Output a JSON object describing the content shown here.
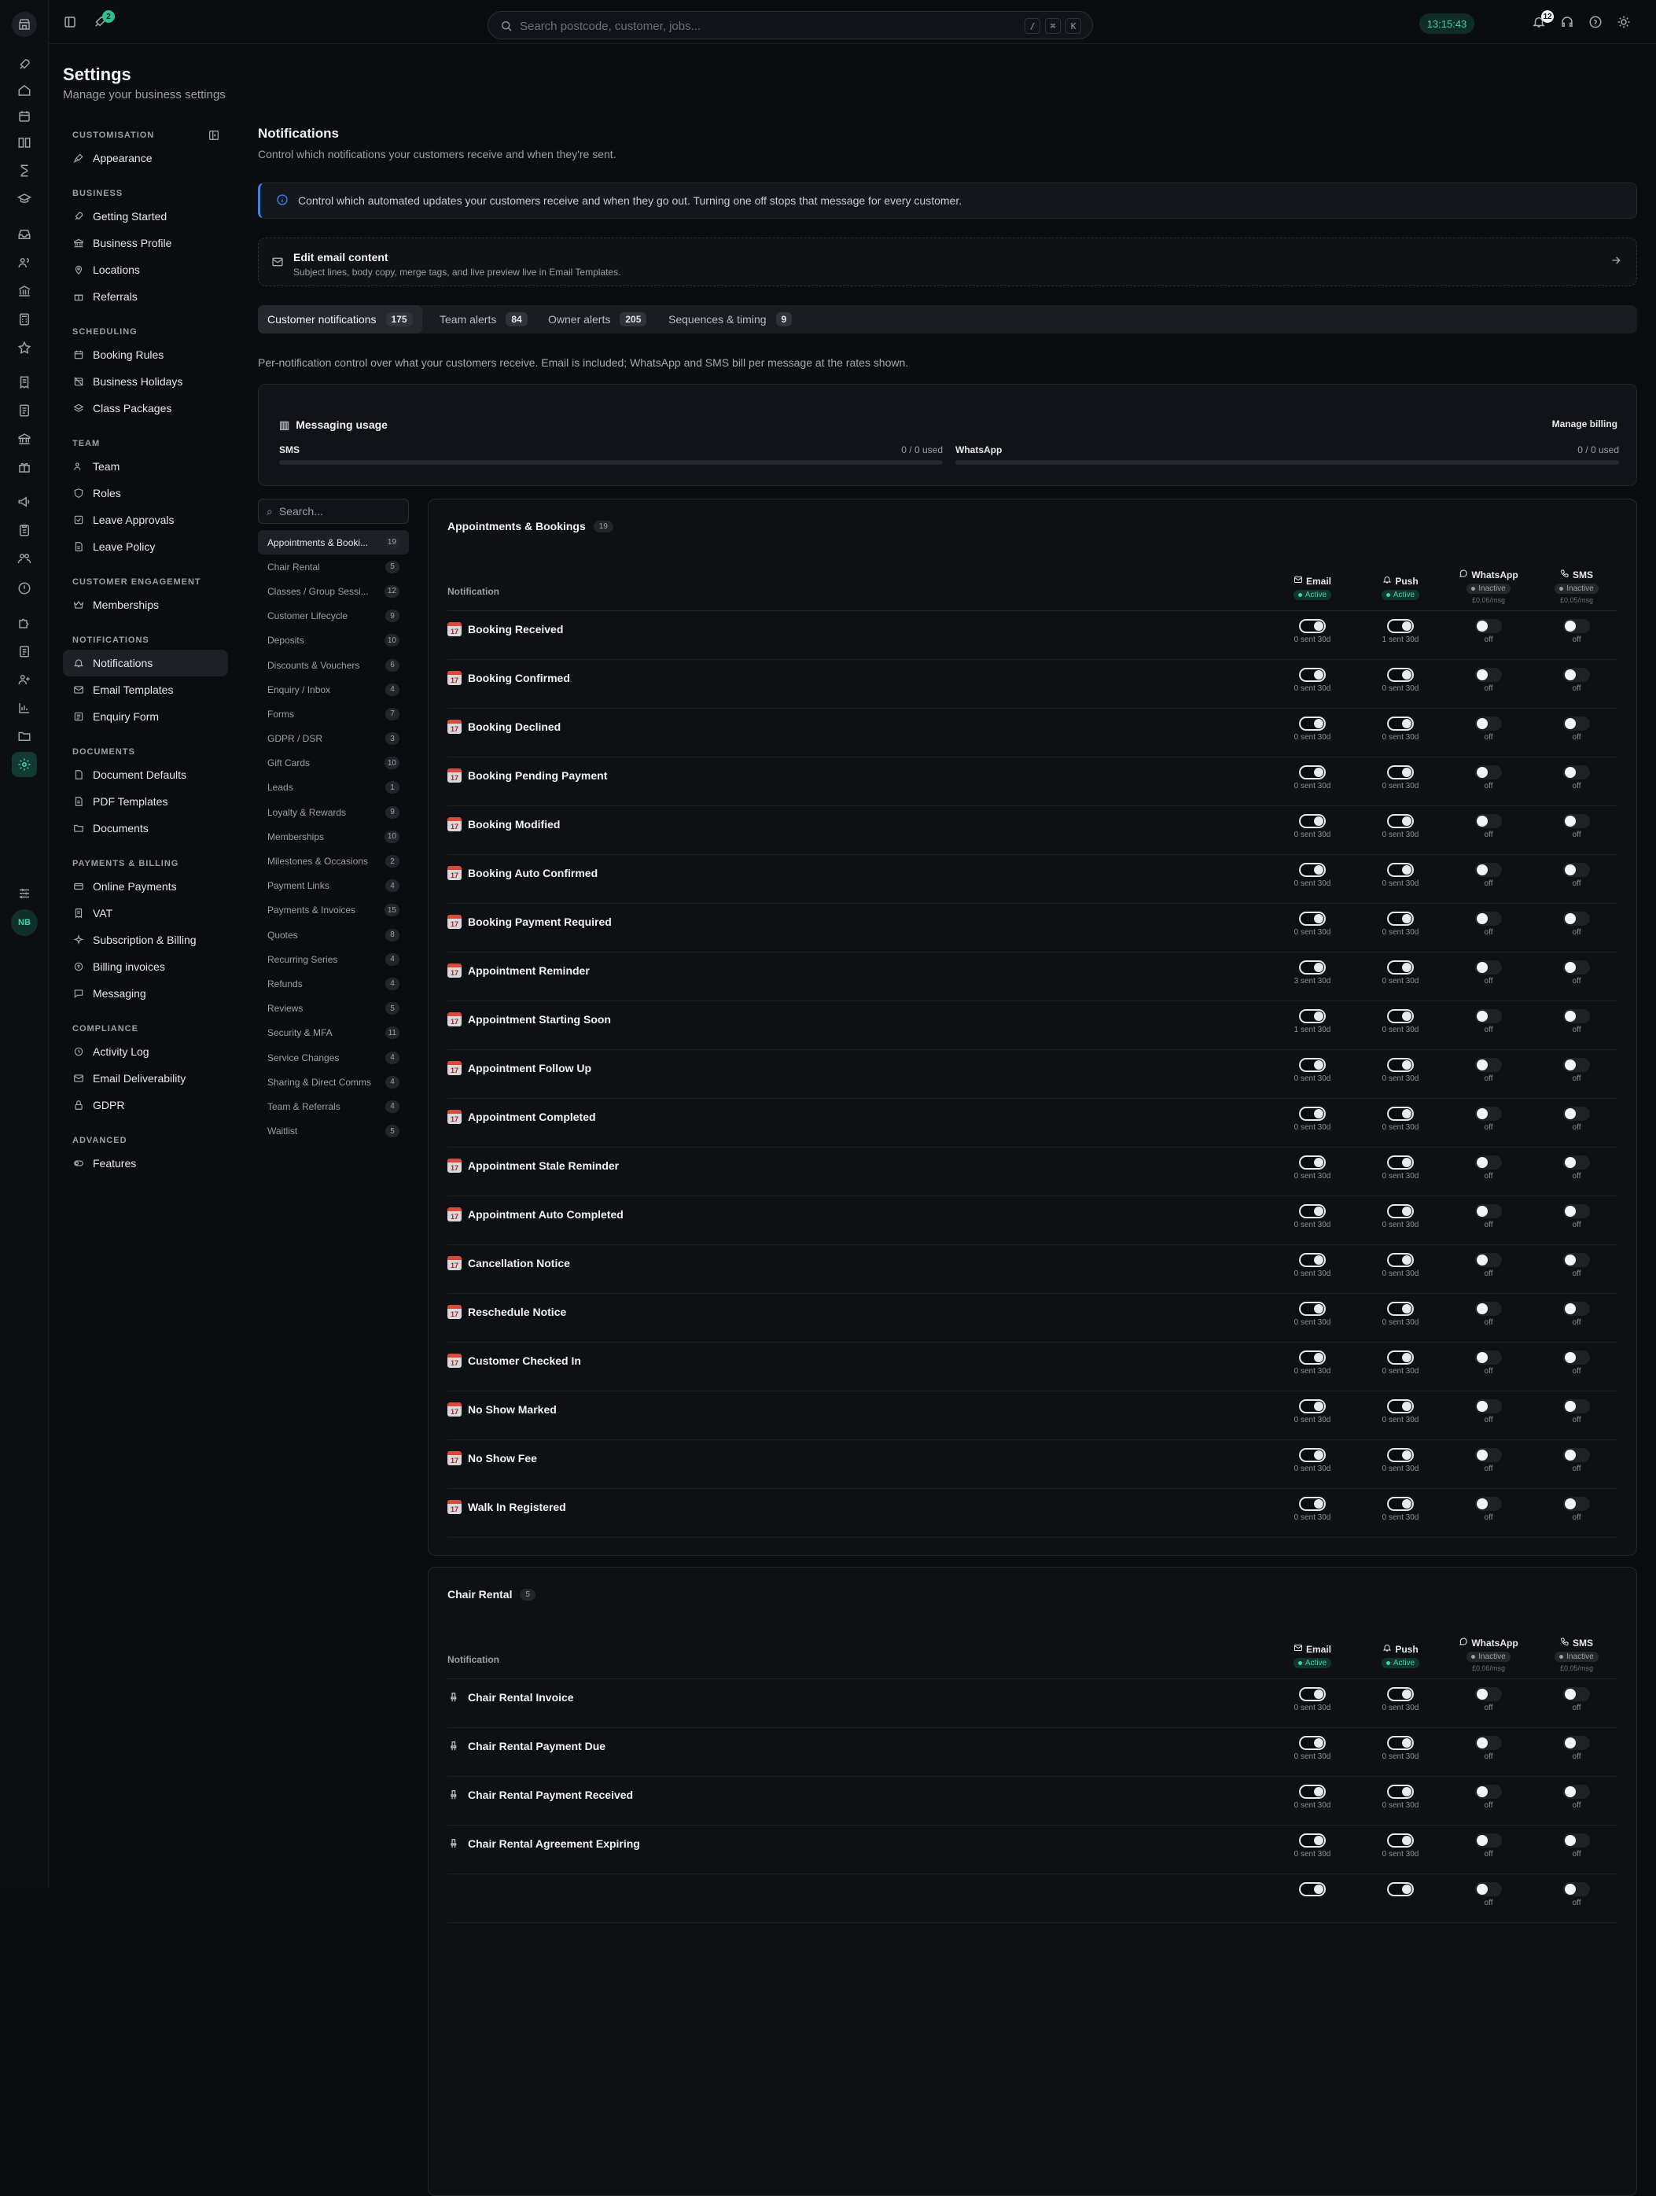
{
  "topbar": {
    "rocket_badge": "2",
    "search_placeholder": "Search postcode, customer, jobs...",
    "kbd": [
      "/",
      "⌘",
      "K"
    ],
    "clock": "13:15:43",
    "bell_badge": "12"
  },
  "rail": {
    "avatar": "NB"
  },
  "page": {
    "title": "Settings",
    "subtitle": "Manage your business settings"
  },
  "settings_nav": [
    {
      "section": "Customisation",
      "items": [
        {
          "label": "Appearance",
          "icon": "brush-icon"
        }
      ]
    },
    {
      "section": "Business",
      "items": [
        {
          "label": "Getting Started",
          "icon": "rocket-icon"
        },
        {
          "label": "Business Profile",
          "icon": "building-icon"
        },
        {
          "label": "Locations",
          "icon": "pin-icon"
        },
        {
          "label": "Referrals",
          "icon": "gift-icon"
        }
      ]
    },
    {
      "section": "Scheduling",
      "items": [
        {
          "label": "Booking Rules",
          "icon": "calendar-icon"
        },
        {
          "label": "Business Holidays",
          "icon": "calendar-off-icon"
        },
        {
          "label": "Class Packages",
          "icon": "layers-icon"
        }
      ]
    },
    {
      "section": "Team",
      "items": [
        {
          "label": "Team",
          "icon": "users-icon"
        },
        {
          "label": "Roles",
          "icon": "shield-icon"
        },
        {
          "label": "Leave Approvals",
          "icon": "check-square-icon"
        },
        {
          "label": "Leave Policy",
          "icon": "doc-icon"
        }
      ]
    },
    {
      "section": "Customer Engagement",
      "items": [
        {
          "label": "Memberships",
          "icon": "crown-icon"
        }
      ]
    },
    {
      "section": "Notifications",
      "items": [
        {
          "label": "Notifications",
          "icon": "bell-icon",
          "selected": true
        },
        {
          "label": "Email Templates",
          "icon": "mail-icon"
        },
        {
          "label": "Enquiry Form",
          "icon": "form-icon"
        }
      ]
    },
    {
      "section": "Documents",
      "items": [
        {
          "label": "Document Defaults",
          "icon": "file-icon"
        },
        {
          "label": "PDF Templates",
          "icon": "file-text-icon"
        },
        {
          "label": "Documents",
          "icon": "folder-icon"
        }
      ]
    },
    {
      "section": "Payments & Billing",
      "items": [
        {
          "label": "Online Payments",
          "icon": "card-icon"
        },
        {
          "label": "VAT",
          "icon": "receipt-icon"
        },
        {
          "label": "Subscription & Billing",
          "icon": "sparkle-icon"
        },
        {
          "label": "Billing invoices",
          "icon": "coin-icon"
        },
        {
          "label": "Messaging",
          "icon": "chat-icon"
        }
      ]
    },
    {
      "section": "Compliance",
      "items": [
        {
          "label": "Activity Log",
          "icon": "history-icon"
        },
        {
          "label": "Email Deliverability",
          "icon": "mail-check-icon"
        },
        {
          "label": "GDPR",
          "icon": "lock-icon"
        }
      ]
    },
    {
      "section": "Advanced",
      "items": [
        {
          "label": "Features",
          "icon": "toggle-icon"
        }
      ]
    }
  ],
  "notifications": {
    "title": "Notifications",
    "subtitle": "Control which notifications your customers receive and when they're sent.",
    "info": "Control which automated updates your customers receive and when they go out. Turning one off stops that message for every customer.",
    "edit_title": "Edit email content",
    "edit_sub": "Subject lines, body copy, merge tags, and live preview live in Email Templates.",
    "tabs": [
      {
        "label": "Customer notifications",
        "count": "175"
      },
      {
        "label": "Team alerts",
        "count": "84"
      },
      {
        "label": "Owner alerts",
        "count": "205"
      },
      {
        "label": "Sequences & timing",
        "count": "9"
      }
    ],
    "per_line": "Per-notification control over what your customers receive. Email is included; WhatsApp and SMS bill per message at the rates shown.",
    "usage": {
      "title": "Messaging usage",
      "manage": "Manage billing",
      "sms_label": "SMS",
      "sms_value": "0 / 0 used",
      "sms_fraction": 0,
      "wa_label": "WhatsApp",
      "wa_value": "0 / 0 used",
      "wa_fraction": 0
    },
    "cat_search": "Search...",
    "categories": [
      {
        "label": "Appointments & Booki...",
        "count": "19",
        "selected": true
      },
      {
        "label": "Chair Rental",
        "count": "5"
      },
      {
        "label": "Classes / Group Sessi...",
        "count": "12"
      },
      {
        "label": "Customer Lifecycle",
        "count": "9"
      },
      {
        "label": "Deposits",
        "count": "10"
      },
      {
        "label": "Discounts & Vouchers",
        "count": "6"
      },
      {
        "label": "Enquiry / Inbox",
        "count": "4"
      },
      {
        "label": "Forms",
        "count": "7"
      },
      {
        "label": "GDPR / DSR",
        "count": "3"
      },
      {
        "label": "Gift Cards",
        "count": "10"
      },
      {
        "label": "Leads",
        "count": "1"
      },
      {
        "label": "Loyalty & Rewards",
        "count": "9"
      },
      {
        "label": "Memberships",
        "count": "10"
      },
      {
        "label": "Milestones & Occasions",
        "count": "2"
      },
      {
        "label": "Payment Links",
        "count": "4"
      },
      {
        "label": "Payments & Invoices",
        "count": "15"
      },
      {
        "label": "Quotes",
        "count": "8"
      },
      {
        "label": "Recurring Series",
        "count": "4"
      },
      {
        "label": "Refunds",
        "count": "4"
      },
      {
        "label": "Reviews",
        "count": "5"
      },
      {
        "label": "Security & MFA",
        "count": "11"
      },
      {
        "label": "Service Changes",
        "count": "4"
      },
      {
        "label": "Sharing & Direct Comms",
        "count": "4"
      },
      {
        "label": "Team & Referrals",
        "count": "4"
      },
      {
        "label": "Waitlist",
        "count": "5"
      }
    ],
    "table": {
      "notif_col": "Notification",
      "channels": [
        {
          "name": "Email",
          "status": "Active",
          "rate": ""
        },
        {
          "name": "Push",
          "status": "Active",
          "rate": ""
        },
        {
          "name": "WhatsApp",
          "status": "Inactive",
          "rate": "£0.06/msg"
        },
        {
          "name": "SMS",
          "status": "Inactive",
          "rate": "£0.05/msg"
        }
      ],
      "off": "off"
    },
    "groups": [
      {
        "title": "Appointments & Bookings",
        "count": "19",
        "icon": "calendar-17-icon",
        "rows": [
          {
            "name": "Booking Received",
            "email": "0 sent 30d",
            "push": "1 sent 30d"
          },
          {
            "name": "Booking Confirmed",
            "email": "0 sent 30d",
            "push": "0 sent 30d"
          },
          {
            "name": "Booking Declined",
            "email": "0 sent 30d",
            "push": "0 sent 30d"
          },
          {
            "name": "Booking Pending Payment",
            "email": "0 sent 30d",
            "push": "0 sent 30d"
          },
          {
            "name": "Booking Modified",
            "email": "0 sent 30d",
            "push": "0 sent 30d"
          },
          {
            "name": "Booking Auto Confirmed",
            "email": "0 sent 30d",
            "push": "0 sent 30d"
          },
          {
            "name": "Booking Payment Required",
            "email": "0 sent 30d",
            "push": "0 sent 30d"
          },
          {
            "name": "Appointment Reminder",
            "email": "3 sent 30d",
            "push": "0 sent 30d"
          },
          {
            "name": "Appointment Starting Soon",
            "email": "1 sent 30d",
            "push": "0 sent 30d"
          },
          {
            "name": "Appointment Follow Up",
            "email": "0 sent 30d",
            "push": "0 sent 30d"
          },
          {
            "name": "Appointment Completed",
            "email": "0 sent 30d",
            "push": "0 sent 30d"
          },
          {
            "name": "Appointment Stale Reminder",
            "email": "0 sent 30d",
            "push": "0 sent 30d"
          },
          {
            "name": "Appointment Auto Completed",
            "email": "0 sent 30d",
            "push": "0 sent 30d"
          },
          {
            "name": "Cancellation Notice",
            "email": "0 sent 30d",
            "push": "0 sent 30d"
          },
          {
            "name": "Reschedule Notice",
            "email": "0 sent 30d",
            "push": "0 sent 30d"
          },
          {
            "name": "Customer Checked In",
            "email": "0 sent 30d",
            "push": "0 sent 30d"
          },
          {
            "name": "No Show Marked",
            "email": "0 sent 30d",
            "push": "0 sent 30d"
          },
          {
            "name": "No Show Fee",
            "email": "0 sent 30d",
            "push": "0 sent 30d"
          },
          {
            "name": "Walk In Registered",
            "email": "0 sent 30d",
            "push": "0 sent 30d"
          }
        ]
      },
      {
        "title": "Chair Rental",
        "count": "5",
        "icon": "chair-icon",
        "rows": [
          {
            "name": "Chair Rental Invoice",
            "email": "0 sent 30d",
            "push": "0 sent 30d"
          },
          {
            "name": "Chair Rental Payment Due",
            "email": "0 sent 30d",
            "push": "0 sent 30d"
          },
          {
            "name": "Chair Rental Payment Received",
            "email": "0 sent 30d",
            "push": "0 sent 30d"
          },
          {
            "name": "Chair Rental Agreement Expiring",
            "email": "0 sent 30d",
            "push": "0 sent 30d"
          },
          {
            "name": "",
            "email": "",
            "push": ""
          }
        ]
      }
    ]
  }
}
